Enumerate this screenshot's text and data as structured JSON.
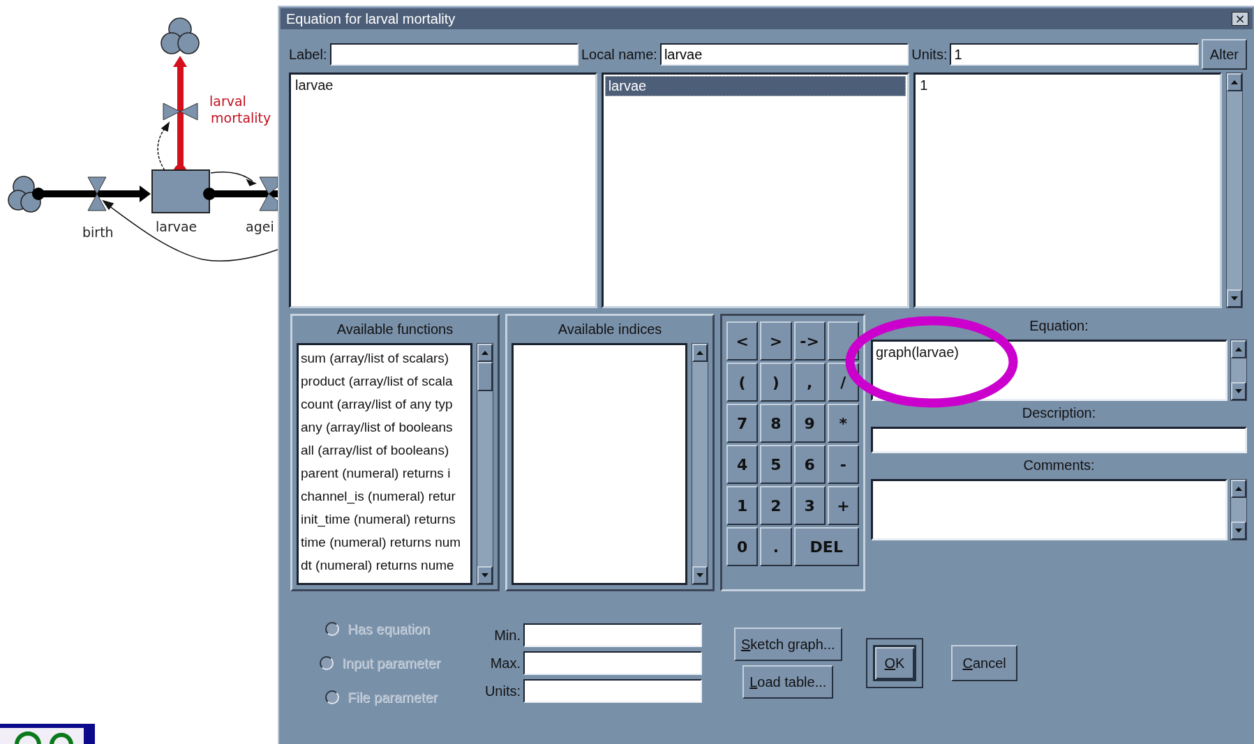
{
  "diagram": {
    "labels": [
      {
        "text": "larval mortality",
        "selected": true
      },
      {
        "text": "birth",
        "selected": false
      },
      {
        "text": "larvae",
        "selected": false
      },
      {
        "text": "agei",
        "selected": false
      }
    ]
  },
  "window": {
    "title": "Equation for larval mortality",
    "close": "×"
  },
  "top_fields": [
    {
      "label": "Label:"
    },
    {
      "label": "Local name:",
      "value": "larvae"
    },
    {
      "label": "Units:",
      "value": "1"
    }
  ],
  "alter_button": "Alter",
  "lists": [
    {
      "items": [
        {
          "text": "larvae",
          "selected": false
        }
      ]
    },
    {
      "items": [
        {
          "text": "larvae",
          "selected": true
        }
      ]
    },
    {
      "items": [
        {
          "text": "1",
          "selected": false
        }
      ]
    }
  ],
  "functions": {
    "title": "Available functions",
    "items": [
      "sum (array/list of scalars)",
      "product (array/list of scala",
      "count (array/list of any typ",
      "any (array/list of booleans",
      "all (array/list of booleans)",
      "parent (numeral) returns i",
      "channel_is (numeral) retur",
      "init_time (numeral) returns",
      "time (numeral) returns num",
      "dt (numeral) returns nume"
    ]
  },
  "indices": {
    "title": "Available indices"
  },
  "keypad": [
    {
      "kind": "key",
      "label": "<"
    },
    {
      "kind": "key",
      "label": ">"
    },
    {
      "kind": "key",
      "label": "->"
    },
    {
      "kind": "covered"
    },
    {
      "kind": "key",
      "label": "("
    },
    {
      "kind": "key",
      "label": ")"
    },
    {
      "kind": "key",
      "label": ","
    },
    {
      "kind": "key",
      "label": "/"
    },
    {
      "kind": "key",
      "label": "7"
    },
    {
      "kind": "key",
      "label": "8"
    },
    {
      "kind": "key",
      "label": "9"
    },
    {
      "kind": "key",
      "label": "*"
    },
    {
      "kind": "key",
      "label": "4"
    },
    {
      "kind": "key",
      "label": "5"
    },
    {
      "kind": "key",
      "label": "6"
    },
    {
      "kind": "key",
      "label": "-"
    },
    {
      "kind": "key",
      "label": "1"
    },
    {
      "kind": "key",
      "label": "2"
    },
    {
      "kind": "key",
      "label": "3"
    },
    {
      "kind": "key",
      "label": "+"
    },
    {
      "kind": "key",
      "label": "0"
    },
    {
      "kind": "key",
      "label": "."
    },
    {
      "kind": "wide",
      "label": "DEL"
    }
  ],
  "equation": {
    "label": "Equation:",
    "value": "graph(larvae)"
  },
  "description": {
    "label": "Description:"
  },
  "comments": {
    "label": "Comments:"
  },
  "modes": [
    {
      "label": "Has equation",
      "selected": false,
      "disabled": true
    },
    {
      "label": "Input parameter",
      "selected": false,
      "disabled": true
    },
    {
      "label": "File parameter",
      "selected": false,
      "disabled": true
    }
  ],
  "range_fields": [
    {
      "label": "Min."
    },
    {
      "label": "Max."
    },
    {
      "label": "Units:"
    }
  ],
  "graph_buttons": [
    {
      "label": "Sketch graph..."
    },
    {
      "label": "Load table..."
    }
  ],
  "dialog_buttons": [
    {
      "label": "OK",
      "default": true
    },
    {
      "label": "Cancel",
      "default": false
    }
  ]
}
